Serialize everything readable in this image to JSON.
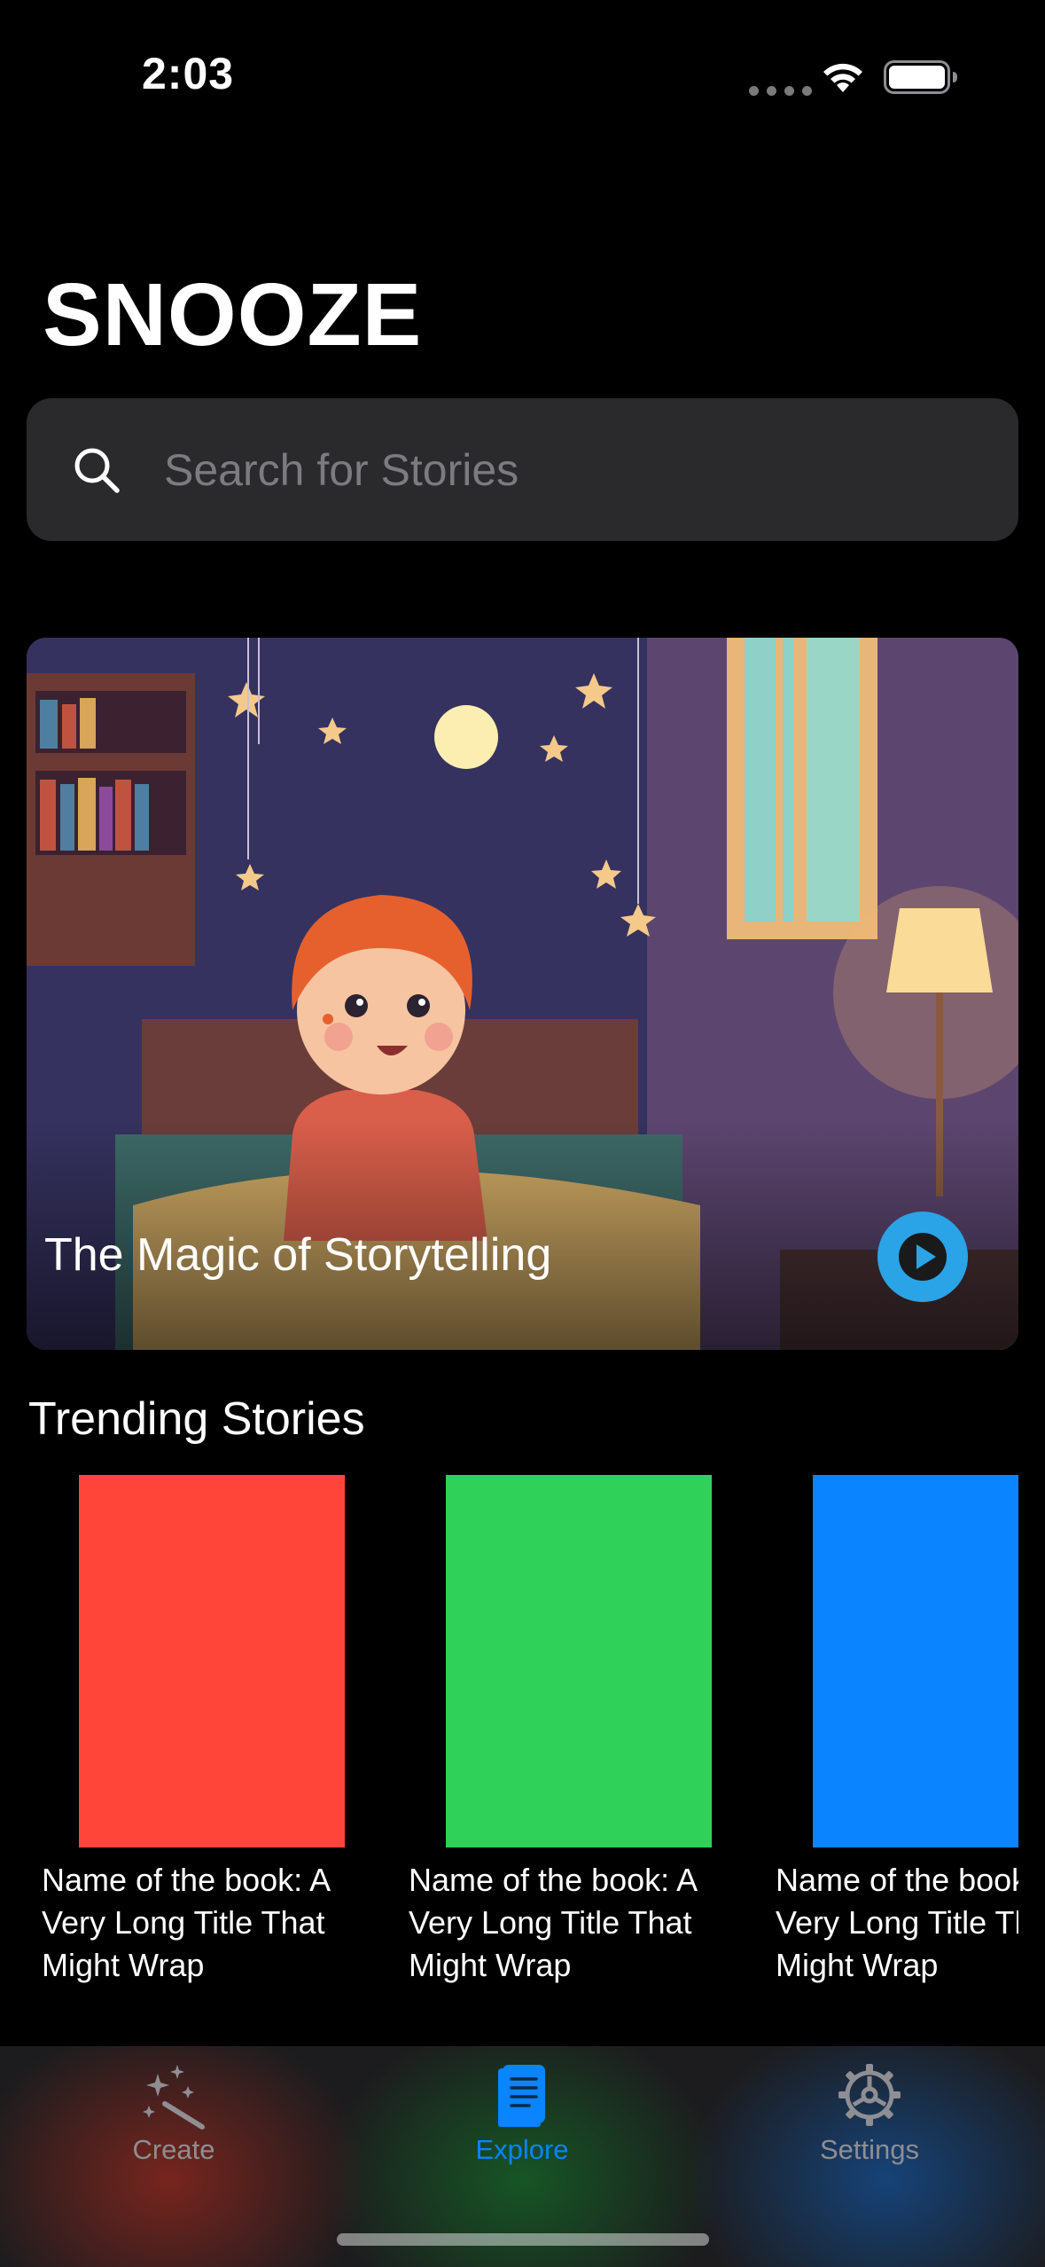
{
  "status_bar": {
    "time": "2:03",
    "icons": [
      "cellular-signal-icon",
      "wifi-icon",
      "battery-icon"
    ]
  },
  "app": {
    "title": "SNOOZE"
  },
  "search": {
    "placeholder": "Search for Stories",
    "value": "",
    "icon": "search-icon"
  },
  "featured": {
    "title": "The Magic of Storytelling",
    "play_icon": "play-icon",
    "accent_color": "#2aa4e6"
  },
  "trending": {
    "heading": "Trending Stories",
    "books": [
      {
        "title": "Name of the book: A Very Long Title That Might Wrap",
        "cover_color": "#ff453a"
      },
      {
        "title": "Name of the book: A Very Long Title That Might Wrap",
        "cover_color": "#30d158"
      },
      {
        "title": "Name of the book: A Very Long Title That Might Wrap",
        "cover_color": "#0a84ff"
      }
    ]
  },
  "tab_bar": {
    "tabs": [
      {
        "label": "Create",
        "icon": "magic-wand-icon",
        "selected": false
      },
      {
        "label": "Explore",
        "icon": "book-icon",
        "selected": true
      },
      {
        "label": "Settings",
        "icon": "gear-icon",
        "selected": false
      }
    ],
    "selected_color": "#0a84ff",
    "unselected_color": "#8e8e93"
  }
}
